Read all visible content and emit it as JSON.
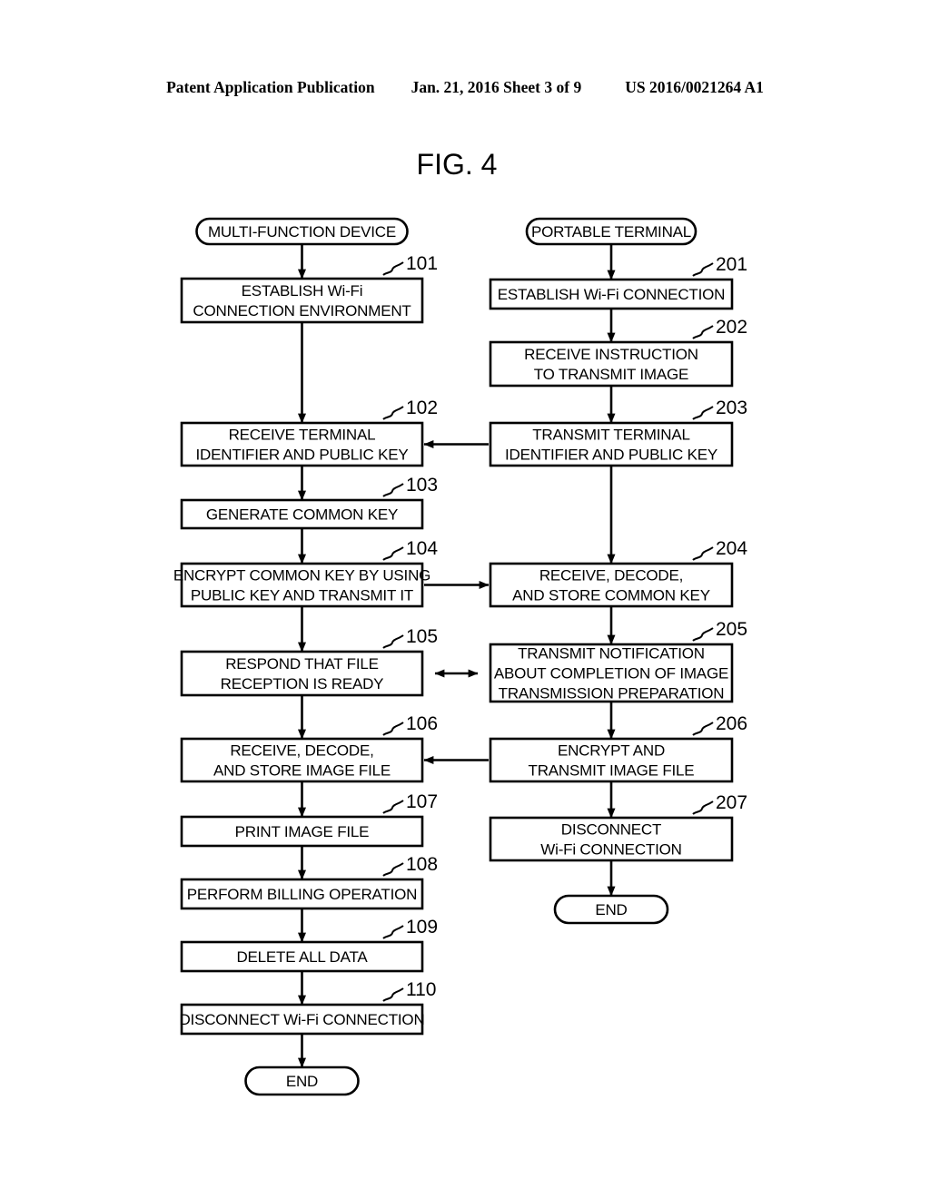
{
  "header": {
    "publication": "Patent Application Publication",
    "date_sheet": "Jan. 21, 2016  Sheet 3 of 9",
    "patent_number": "US 2016/0021264 A1"
  },
  "figure": {
    "title": "FIG. 4"
  },
  "columns": [
    {
      "id": "left",
      "start_label": "MULTI-FUNCTION DEVICE",
      "end_label": "END"
    },
    {
      "id": "right",
      "start_label": "PORTABLE TERMINAL",
      "end_label": "END"
    }
  ],
  "left_steps": [
    {
      "ref": "101",
      "lines": [
        "ESTABLISH Wi-Fi",
        "CONNECTION ENVIRONMENT"
      ]
    },
    {
      "ref": "102",
      "lines": [
        "RECEIVE TERMINAL",
        "IDENTIFIER AND PUBLIC KEY"
      ]
    },
    {
      "ref": "103",
      "lines": [
        "GENERATE COMMON KEY"
      ]
    },
    {
      "ref": "104",
      "lines": [
        "ENCRYPT COMMON KEY BY USING",
        "PUBLIC KEY AND TRANSMIT IT"
      ]
    },
    {
      "ref": "105",
      "lines": [
        "RESPOND THAT FILE",
        "RECEPTION IS READY"
      ]
    },
    {
      "ref": "106",
      "lines": [
        "RECEIVE, DECODE,",
        "AND STORE IMAGE FILE"
      ]
    },
    {
      "ref": "107",
      "lines": [
        "PRINT IMAGE FILE"
      ]
    },
    {
      "ref": "108",
      "lines": [
        "PERFORM BILLING OPERATION"
      ]
    },
    {
      "ref": "109",
      "lines": [
        "DELETE ALL DATA"
      ]
    },
    {
      "ref": "110",
      "lines": [
        "DISCONNECT Wi-Fi CONNECTION"
      ]
    }
  ],
  "right_steps": [
    {
      "ref": "201",
      "lines": [
        "ESTABLISH Wi-Fi CONNECTION"
      ]
    },
    {
      "ref": "202",
      "lines": [
        "RECEIVE INSTRUCTION",
        "TO TRANSMIT IMAGE"
      ]
    },
    {
      "ref": "203",
      "lines": [
        "TRANSMIT TERMINAL",
        "IDENTIFIER AND PUBLIC KEY"
      ]
    },
    {
      "ref": "204",
      "lines": [
        "RECEIVE, DECODE,",
        "AND STORE COMMON KEY"
      ]
    },
    {
      "ref": "205",
      "lines": [
        "TRANSMIT NOTIFICATION",
        "ABOUT COMPLETION OF IMAGE",
        "TRANSMISSION PREPARATION"
      ]
    },
    {
      "ref": "206",
      "lines": [
        "ENCRYPT AND",
        "TRANSMIT IMAGE FILE"
      ]
    },
    {
      "ref": "207",
      "lines": [
        "DISCONNECT",
        "Wi-Fi CONNECTION"
      ]
    }
  ],
  "cross_links": [
    {
      "from": "203",
      "to": "102",
      "direction": "left"
    },
    {
      "from": "104",
      "to": "204",
      "direction": "right"
    },
    {
      "from": "105",
      "to": "205",
      "direction": "both"
    },
    {
      "from": "206",
      "to": "106",
      "direction": "left"
    }
  ],
  "colors": {
    "ink": "#000000",
    "paper": "#ffffff"
  }
}
